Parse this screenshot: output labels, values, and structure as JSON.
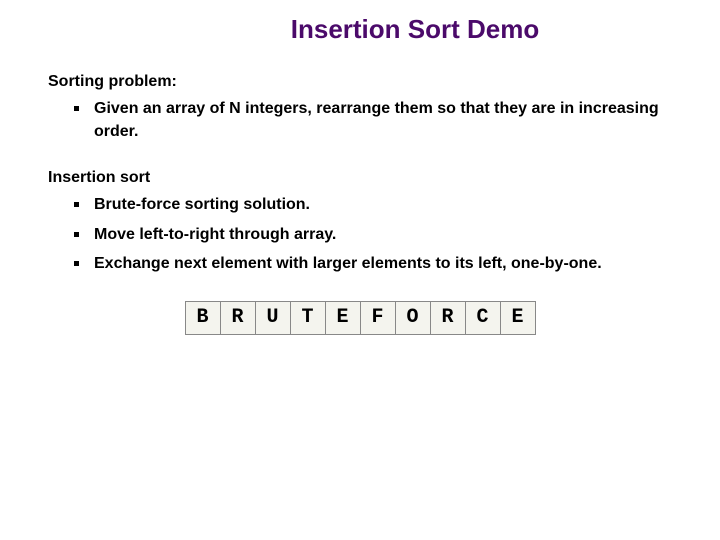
{
  "title": "Insertion Sort Demo",
  "section1": {
    "heading": "Sorting problem:",
    "items": [
      "Given an array of N integers, rearrange them so that they are in increasing order."
    ]
  },
  "section2": {
    "heading": "Insertion sort",
    "items": [
      "Brute-force sorting solution.",
      "Move left-to-right through array.",
      "Exchange next element with larger elements to its left, one-by-one."
    ]
  },
  "array": [
    "B",
    "R",
    "U",
    "T",
    "E",
    "F",
    "O",
    "R",
    "C",
    "E"
  ]
}
